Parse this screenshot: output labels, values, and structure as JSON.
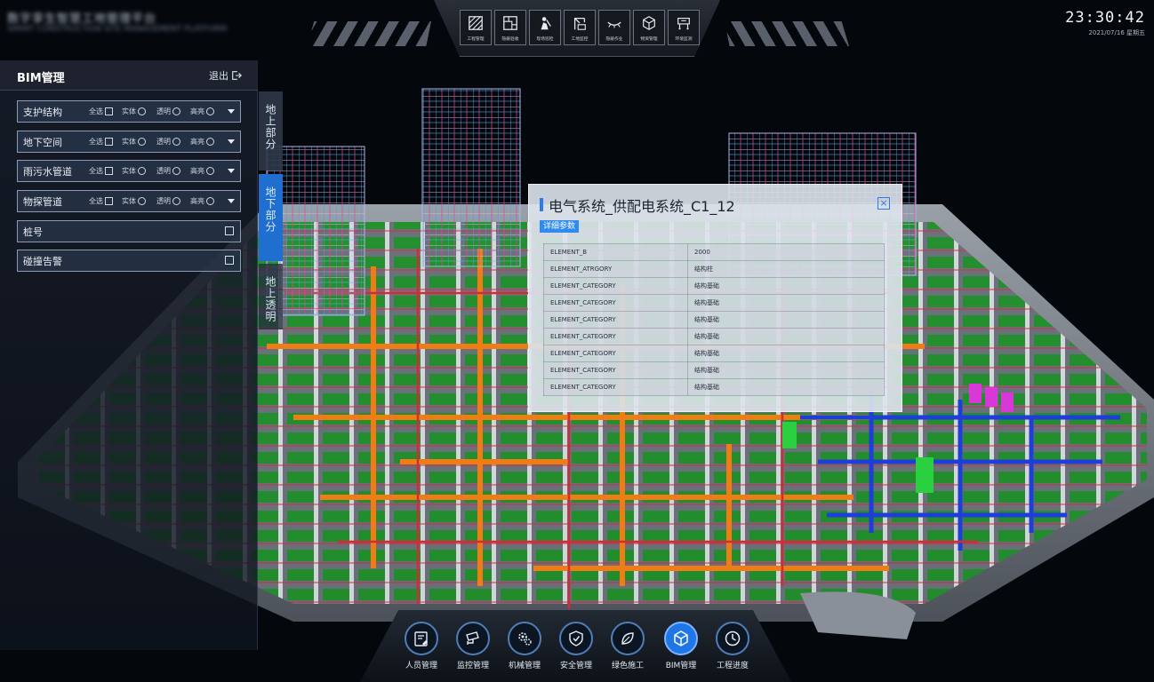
{
  "header": {
    "app_title": "数字孪生智慧工地管理平台",
    "app_subtitle": "SMART CONSTRUCTION SITE MANAGEMENT PLATFORM",
    "clock": {
      "time": "23:30:42",
      "date": "2021/07/16 星期五"
    },
    "toolbar": [
      {
        "label": "工程管理",
        "icon": "hatch-icon"
      },
      {
        "label": "隐蔽验收",
        "icon": "blueprint-icon"
      },
      {
        "label": "现场巡检",
        "icon": "worker-icon"
      },
      {
        "label": "工地监控",
        "icon": "crane-icon"
      },
      {
        "label": "隐蔽作业",
        "icon": "eye-closed-icon"
      },
      {
        "label": "物资管理",
        "icon": "cube-icon"
      },
      {
        "label": "环境监测",
        "icon": "cart-icon"
      }
    ]
  },
  "bim": {
    "title": "BIM管理",
    "exit_label": "退出",
    "options": {
      "all": "全选",
      "solid": "实体",
      "transparent": "透明",
      "highlight": "高亮"
    },
    "layers": [
      {
        "label": "支护结构"
      },
      {
        "label": "地下空间"
      },
      {
        "label": "雨污水管道"
      },
      {
        "label": "物探管道"
      }
    ],
    "checks": [
      {
        "label": "桩号"
      },
      {
        "label": "碰撞告警"
      }
    ],
    "side_tabs": [
      {
        "label": "地上部分",
        "active": false
      },
      {
        "label": "地下部分",
        "active": true
      },
      {
        "label": "地上透明",
        "active": false
      }
    ]
  },
  "popup": {
    "title": "电气系统_供配电系统_C1_12",
    "tab_label": "详细参数",
    "close_icon": "close-icon",
    "rows": [
      {
        "key": "ELEMENT_B",
        "value": "2000"
      },
      {
        "key": "ELEMENT_ATRGORY",
        "value": "结构柱"
      },
      {
        "key": "ELEMENT_CATEGORY",
        "value": "结构基础"
      },
      {
        "key": "ELEMENT_CATEGORY",
        "value": "结构基础"
      },
      {
        "key": "ELEMENT_CATEGORY",
        "value": "结构基础"
      },
      {
        "key": "ELEMENT_CATEGORY",
        "value": "结构基础"
      },
      {
        "key": "ELEMENT_CATEGORY",
        "value": "结构基础"
      },
      {
        "key": "ELEMENT_CATEGORY",
        "value": "结构基础"
      },
      {
        "key": "ELEMENT_CATEGORY",
        "value": "结构基础"
      }
    ]
  },
  "bottom_nav": [
    {
      "label": "人员管理",
      "icon": "person-card-icon",
      "active": false
    },
    {
      "label": "监控管理",
      "icon": "camera-icon",
      "active": false
    },
    {
      "label": "机械管理",
      "icon": "gears-icon",
      "active": false
    },
    {
      "label": "安全管理",
      "icon": "shield-check-icon",
      "active": false
    },
    {
      "label": "绿色施工",
      "icon": "leaf-icon",
      "active": false
    },
    {
      "label": "BIM管理",
      "icon": "cube-icon",
      "active": true
    },
    {
      "label": "工程进度",
      "icon": "clock-icon",
      "active": false
    }
  ],
  "colors": {
    "accent": "#1f76e6",
    "pipe_orange": "#f07d14",
    "floor_green": "#1f8f2a",
    "pipe_blue": "#1d3fd8",
    "pipe_red": "#d22c36",
    "pipe_magenta": "#d838d8",
    "slab_gray": "#8c929c"
  }
}
